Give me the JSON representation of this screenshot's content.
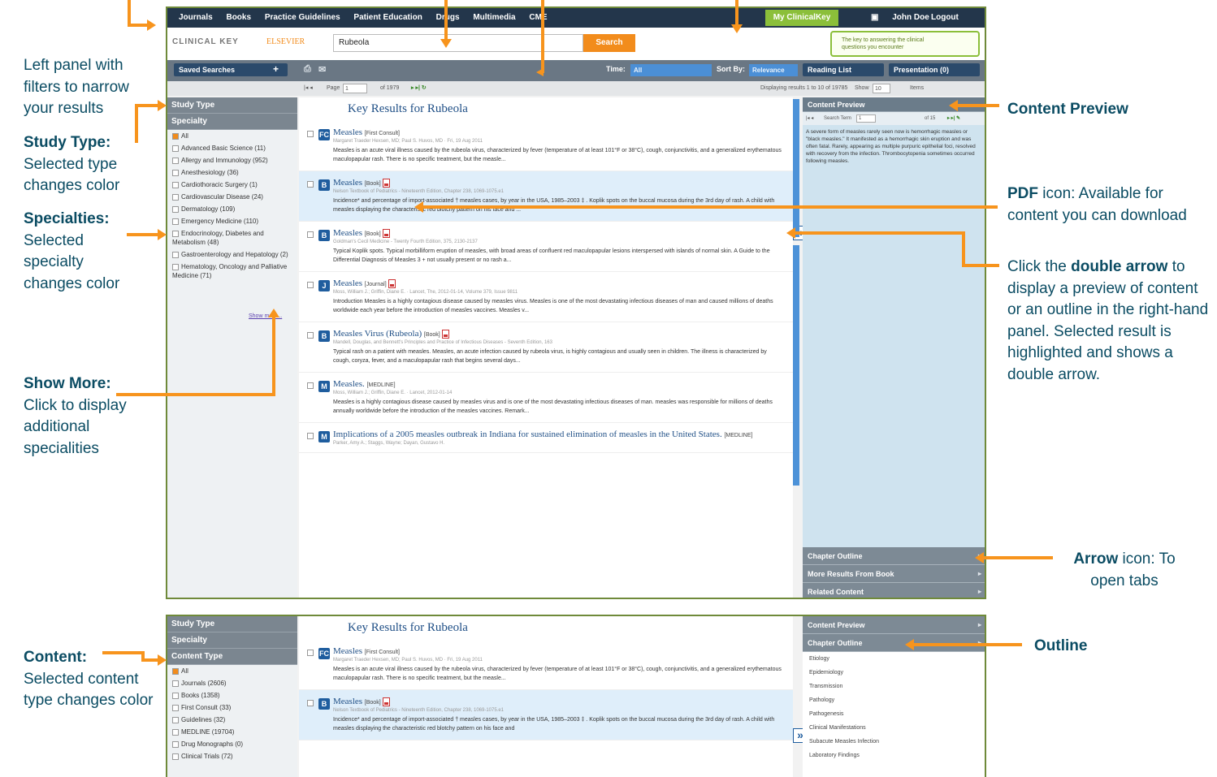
{
  "colors": {
    "annotation_text": "#0b4c63",
    "annotation_arrow": "#f7941d",
    "topbar": "#23364b",
    "accent_green": "#8bbf3a",
    "selected_result": "#dfeefa",
    "search_button": "#f28c1c"
  },
  "annotations": {
    "left_panel": "Left panel with filters to narrow your results",
    "study_type_title": "Study Type:",
    "study_type_body": "Selected type changes color",
    "specialties_title": "Specialties:",
    "specialties_body": "Selected specialty changes color",
    "show_more_title": "Show More:",
    "show_more_body": "Click to display additional specialities",
    "content_preview": "Content Preview",
    "pdf_title": "PDF",
    "pdf_body": " icon: Available for content you can download",
    "double_arrow_pre": "Click the ",
    "double_arrow_bold": "double arrow",
    "double_arrow_post": " to display a preview of content or an outline in the right-hand panel. Selected result is highlighted and shows a double arrow.",
    "arrow_title": "Arrow",
    "arrow_body": " icon: To open tabs",
    "content_title": "Content:",
    "content_body": "Selected content type changes color",
    "outline": "Outline"
  },
  "app": {
    "nav": [
      "Journals",
      "Books",
      "Practice Guidelines",
      "Patient Education",
      "Drugs",
      "Multimedia",
      "CME"
    ],
    "my_clinicalkey": "My ClinicalKey",
    "user": "John Doe",
    "logout": "Logout",
    "logo": "CLINICAL KEY",
    "publisher": "ELSEVIER",
    "search_value": "Rubeola",
    "search_button": "Search",
    "promo": "The key to answering the clinical questions you encounter",
    "saved_searches": "Saved Searches",
    "time_label": "Time:",
    "time_value": "All",
    "sort_label": "Sort By:",
    "sort_value": "Relevance",
    "reading_list": "Reading List",
    "presentation": "Presentation (0)",
    "page_label": "Page",
    "page_value": "1",
    "page_total": "of 1979",
    "display_info": "Displaying results 1 to 10 of 19785",
    "show_label": "Show",
    "show_value": "10",
    "items_label": "Items"
  },
  "filters": {
    "study_type": "Study Type",
    "specialty": "Specialty",
    "content_type": "Content Type",
    "show_more": "Show more...",
    "specialties": [
      "All",
      "Advanced Basic Science (11)",
      "Allergy and Immunology (952)",
      "Anesthesiology (36)",
      "Cardiothoracic Surgery (1)",
      "Cardiovascular Disease (24)",
      "Dermatology (109)",
      "Emergency Medicine (110)",
      "Endocrinology, Diabetes and Metabolism (48)",
      "Gastroenterology and Hepatology (2)",
      "Hematology, Oncology and Palliative Medicine (71)"
    ],
    "content_types": [
      "All",
      "Journals (2606)",
      "Books (1358)",
      "First Consult (33)",
      "Guidelines (32)",
      "MEDLINE (19704)",
      "Drug Monographs (0)",
      "Clinical Trials (72)"
    ]
  },
  "results_heading": "Key Results for Rubeola",
  "results": [
    {
      "icon": "FC",
      "title": "Measles",
      "type": "[First Consult]",
      "meta": "Margaret Traeder Hexsen, MD; Paul S. Huvos, MD · Fri, 19 Aug 2011",
      "text": "Measles is an acute viral illness caused by the rubeola virus, characterized by fever (temperature of at least 101°F or 38°C), cough, conjunctivitis, and a generalized erythematous maculopapular rash. There is no specific treatment, but the measle...",
      "pdf": false
    },
    {
      "icon": "B",
      "title": "Measles",
      "type": "[Book]",
      "meta": "Nelson Textbook of Pediatrics - Nineteenth Edition, Chapter 238, 1069-1075.e1",
      "text": "Incidence* and percentage of import-associated † measles cases, by year in the USA, 1985–2003 ‡ . Koplik spots on the buccal mucosa during the 3rd day of rash. A child with measles displaying the characteristic red blotchy pattern on his face and ...",
      "pdf": true
    },
    {
      "icon": "B",
      "title": "Measles",
      "type": "[Book]",
      "meta": "Goldman's Cecil Medicine - Twenty Fourth Edition, 375, 2130-2137",
      "text": "Typical Koplik spots. Typical morbilliform eruption of measles, with broad areas of confluent red maculopapular lesions interspersed with islands of normal skin. A Guide to the Differential Diagnosis of Measles 3 + not usually present or no rash a...",
      "pdf": true
    },
    {
      "icon": "J",
      "title": "Measles",
      "type": "[Journal]",
      "meta": "Moss, William J.; Griffin, Diane E. · Lancet, The, 2012-01-14, Volume 379, Issue 9811",
      "text": "Introduction Measles is a highly contagious disease caused by measles virus. Measles is one of the most devastating infectious diseases of man and caused millions of deaths worldwide each year before the introduction of measles vaccines. Measles v...",
      "pdf": true
    },
    {
      "icon": "B",
      "title": "Measles Virus (Rubeola)",
      "type": "[Book]",
      "meta": "Mandell, Douglas, and Bennett's Principles and Practice of Infectious Diseases - Seventh Edition, 163",
      "text": "Typical rash on a patient with measles. Measles, an acute infection caused by rubeola virus, is highly contagious and usually seen in children. The illness is characterized by cough, coryza, fever, and a maculopapular rash that begins several days...",
      "pdf": true
    },
    {
      "icon": "M",
      "title": "Measles.",
      "type": "[MEDLINE]",
      "meta": "Moss, William J.; Griffin, Diane E. · Lancet, 2012-01-14",
      "text": "Measles is a highly contagious disease caused by measles virus and is one of the most devastating infectious diseases of man. measles was responsible for millions of deaths annually worldwide before the introduction of the measles vaccines. Remark...",
      "pdf": false
    },
    {
      "icon": "M",
      "title": "Implications of a 2005 measles outbreak in Indiana for sustained elimination of measles in the United States.",
      "type": "[MEDLINE]",
      "meta": "Parker, Amy A.; Staggs, Wayne; Dayan, Gustavo H.",
      "text": "",
      "pdf": false
    }
  ],
  "results_bottom": [
    {
      "icon": "FC",
      "title": "Measles",
      "type": "[First Consult]",
      "meta": "Margaret Traeder Hexsen, MD; Paul S. Huvos, MD · Fri, 19 Aug 2011",
      "text": "Measles is an acute viral illness caused by the rubeola virus, characterized by fever (temperature of at least 101°F or 38°C), cough, conjunctivitis, and a generalized erythematous maculopapular rash. There is no specific treatment, but the measle...",
      "pdf": false
    },
    {
      "icon": "B",
      "title": "Measles",
      "type": "[Book]",
      "meta": "Nelson Textbook of Pediatrics - Nineteenth Edition, Chapter 238, 1069-1075.e1",
      "text": "Incidence* and percentage of import-associated † measles cases, by year in the USA, 1985–2003 ‡ . Koplik spots on the buccal mucosa during the 3rd day of rash. A child with measles displaying the characteristic red blotchy pattern on his face and",
      "pdf": true
    }
  ],
  "preview": {
    "header": "Content Preview",
    "search_term_label": "Search Term",
    "search_term_index": "1",
    "search_term_total": "of 15",
    "text": "A severe form of measles rarely seen now is hemorrhagic measles or \"black measles.\" It manifested as a hemorrhagic skin eruption and was often fatal. Rarely, appearing as multiple purpuric epithelial foci, resolved with recovery from the infection. Thrombocytopenia sometimes occurred following measles.",
    "tabs": [
      "Chapter Outline",
      "More Results From Book",
      "Related Content"
    ]
  },
  "outline": {
    "header_preview": "Content Preview",
    "header_outline": "Chapter Outline",
    "items": [
      "Etiology",
      "Epidemiology",
      "Transmission",
      "Pathology",
      "Pathogenesis",
      "Clinical Manifestations",
      "Subacute Measles Infection",
      "Laboratory Findings"
    ]
  }
}
